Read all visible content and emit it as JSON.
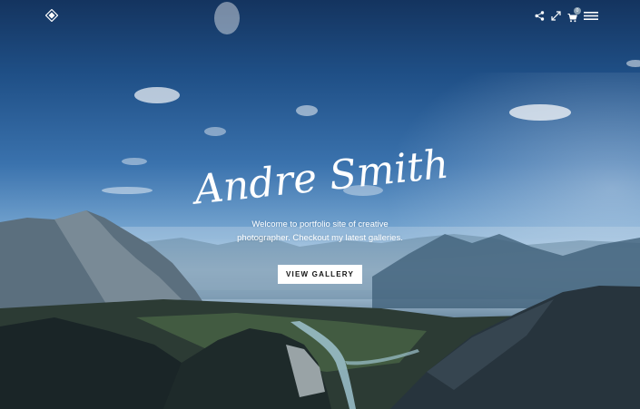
{
  "header": {
    "logo_icon": "diamond-logo-icon",
    "actions": [
      {
        "icon": "share-icon"
      },
      {
        "icon": "fullscreen-icon"
      },
      {
        "icon": "cart-icon",
        "badge": "0"
      },
      {
        "icon": "menu-icon"
      }
    ]
  },
  "hero": {
    "name": "Andre Smith",
    "tagline_line1": "Welcome to portfolio site of creative",
    "tagline_line2": "photographer. Checkout my latest galleries.",
    "cta_label": "VIEW GALLERY"
  },
  "colors": {
    "text": "#ffffff",
    "button_bg": "#ffffff",
    "button_text": "#111111"
  }
}
